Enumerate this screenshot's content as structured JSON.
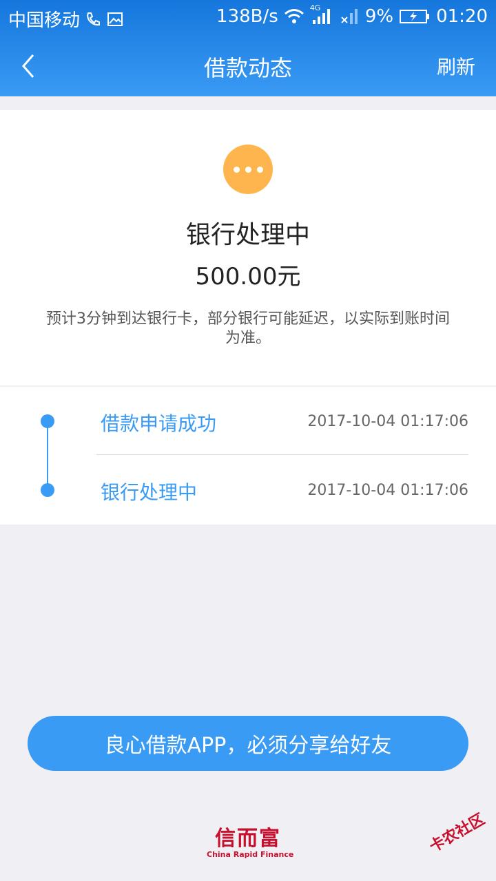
{
  "status_bar": {
    "carrier": "中国移动",
    "speed": "138B/s",
    "network_badge": "4G",
    "battery": "9%",
    "time": "01:20"
  },
  "nav": {
    "title": "借款动态",
    "refresh_label": "刷新"
  },
  "summary": {
    "status": "银行处理中",
    "amount": "500.00元",
    "note": "预计3分钟到达银行卡，部分银行可能延迟，以实际到账时间为准。",
    "status_color": "#ffb54d"
  },
  "timeline": [
    {
      "label": "借款申请成功",
      "time": "2017-10-04 01:17:06"
    },
    {
      "label": "银行处理中",
      "time": "2017-10-04 01:17:06"
    }
  ],
  "share_button": {
    "label": "良心借款APP，必须分享给好友"
  },
  "brand": {
    "cn": "信而富",
    "en": "China Rapid Finance"
  },
  "watermark": {
    "text": "卡农社区"
  },
  "colors": {
    "accent": "#3a9bf5",
    "brand": "#c8102e"
  }
}
